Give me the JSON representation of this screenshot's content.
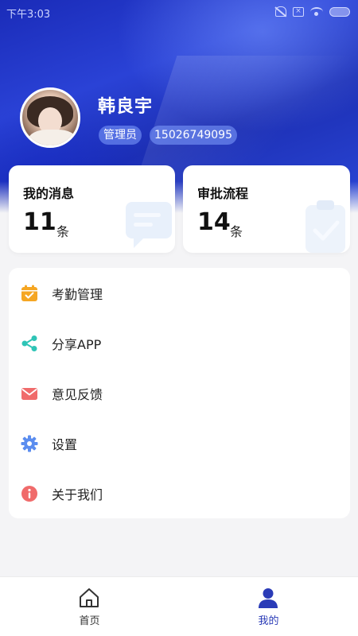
{
  "status_bar": {
    "time": "下午3:03"
  },
  "profile": {
    "name": "韩良宇",
    "role": "管理员",
    "phone": "15026749095"
  },
  "cards": {
    "messages": {
      "title": "我的消息",
      "count": "11",
      "unit": "条"
    },
    "approvals": {
      "title": "审批流程",
      "count": "14",
      "unit": "条"
    }
  },
  "menu": {
    "items": [
      {
        "label": "考勤管理",
        "icon": "calendar-icon",
        "color": "#f5a623"
      },
      {
        "label": "分享APP",
        "icon": "share-icon",
        "color": "#2ec4b6"
      },
      {
        "label": "意见反馈",
        "icon": "mail-icon",
        "color": "#f06b6b"
      },
      {
        "label": "设置",
        "icon": "gear-icon",
        "color": "#5b8def"
      },
      {
        "label": "关于我们",
        "icon": "info-icon",
        "color": "#f06b6b"
      }
    ]
  },
  "tabbar": {
    "home": {
      "label": "首页",
      "icon": "home-icon"
    },
    "mine": {
      "label": "我的",
      "icon": "user-icon",
      "active": true
    }
  },
  "colors": {
    "brand": "#2a3bb7",
    "background": "#f4f4f6"
  }
}
